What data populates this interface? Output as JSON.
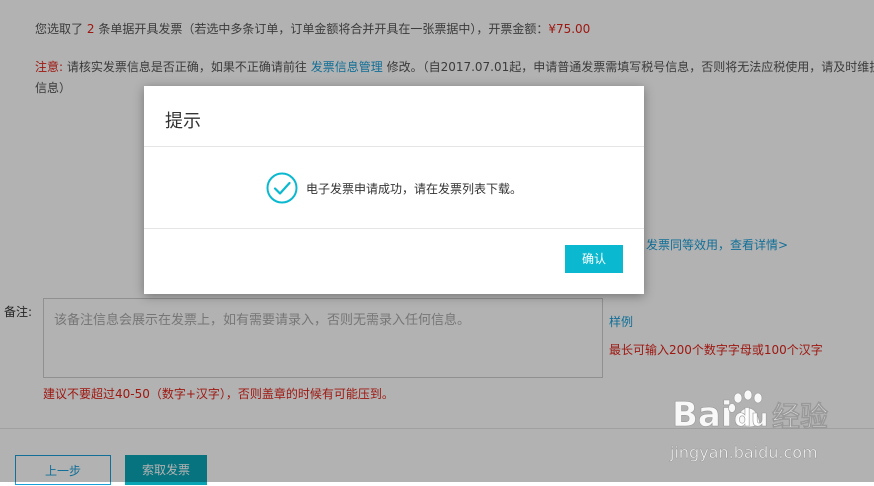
{
  "summary": {
    "prefix": "您选取了",
    "count": "2",
    "suffix": "条单据开具发票（若选中多条订单，订单金额将合并开具在一张票据中），开票金额：",
    "amount": "¥75.00"
  },
  "notice": {
    "label": "注意:",
    "text_before": "请核实发票信息是否正确，如果不正确请前往",
    "link": "发票信息管理",
    "text_after": "修改。（自2017.07.01起，申请普通发票需填写税号信息，否则将无法应税使用，请及时维护信息）"
  },
  "partial_link": "发票同等效用，查看详情>",
  "remark": {
    "label": "备注:",
    "placeholder": "该备注信息会展示在发票上，如有需要请录入，否则无需录入任何信息。",
    "sample_link": "样例",
    "max_len": "最长可输入200个数字字母或100个汉字",
    "hint": "建议不要超过40-50（数字+汉字），否则盖章的时候有可能压到。"
  },
  "buttons": {
    "prev": "上一步",
    "get_invoice": "索取发票"
  },
  "dialog": {
    "title": "提示",
    "message": "电子发票申请成功，请在发票列表下载。",
    "ok": "确认"
  },
  "watermark": {
    "brand": "Bai",
    "brand2": "du",
    "cn": "经验",
    "url": "jingyan.baidu.com"
  },
  "colors": {
    "accent": "#0ab9cf",
    "link": "#1a9fd9",
    "warning": "#e2231a"
  }
}
